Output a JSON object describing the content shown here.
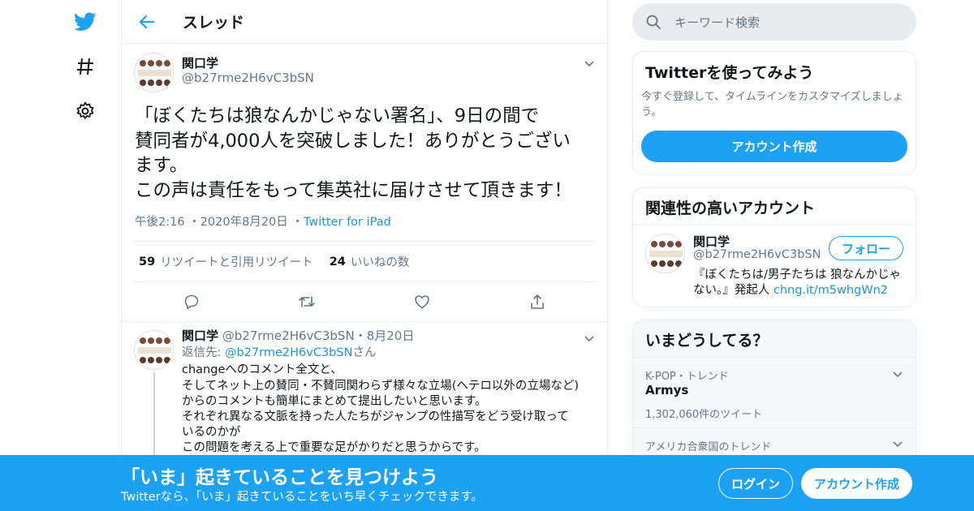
{
  "nav": {
    "icons": [
      "twitter-bird-icon",
      "hashtag-icon",
      "gear-icon"
    ]
  },
  "header": {
    "title": "スレッド"
  },
  "tweet": {
    "name": "関口学",
    "handle": "@b27rme2H6vC3bSN",
    "lines": [
      "「ぼくたちは狼なんかじゃない署名」、9日の間で",
      "賛同者が4,000人を突破しました！ありがとうござい",
      "ます。",
      "この声は責任をもって集英社に届けさせて頂きます！"
    ],
    "time": "午後2:16",
    "date": "2020年8月20日",
    "source": "Twitter for iPad",
    "retweets": "59",
    "retweets_label": "リツイートと引用リツイート",
    "likes": "24",
    "likes_label": "いいねの数"
  },
  "reply": {
    "name": "関口学",
    "handle": "@b27rme2H6vC3bSN",
    "date": "8月20日",
    "reply_to_prefix": "返信先: ",
    "reply_to_handle": "@b27rme2H6vC3bSN",
    "reply_to_suffix": "さん",
    "lines": [
      "changeへのコメント全文と、",
      "そしてネット上の賛同・不賛同関わらず様々な立場(ヘテロ以外の立場など)",
      "からのコメントも簡単にまとめて提出したいと思います。",
      "それぞれ異なる文脈を持った人たちがジャンプの性描写をどう受け取って",
      "いるのかが",
      "この問題を考える上で重要な足がかりだと思うからです。"
    ]
  },
  "search": {
    "placeholder": "キーワード検索"
  },
  "signup_card": {
    "title": "Twitterを使ってみよう",
    "subtitle": "今すぐ登録して、タイムラインをカスタマイズしましょう。",
    "button": "アカウント作成"
  },
  "related_card": {
    "title": "関連性の高いアカウント",
    "name": "関口学",
    "handle": "@b27rme2H6vC3bSN",
    "follow": "フォロー",
    "bio": "『ぼくたちは/男子たちは 狼なんかじゃない。』発起人 ",
    "bio_link": "chng.it/m5whgWn2"
  },
  "trends_card": {
    "title": "いまどうしてる？",
    "items": [
      {
        "context": "K-POP・トレンド",
        "name": "Armys",
        "count": "1,302,060件のツイート"
      },
      {
        "context": "アメリカ合衆国のトレンド",
        "name": "",
        "count": ""
      }
    ]
  },
  "bottom_bar": {
    "title": "「いま」起きていることを見つけよう",
    "subtitle": "Twitterなら、「いま」起きていることをいち早くチェックできます。",
    "login": "ログイン",
    "signup": "アカウント作成"
  },
  "colors": {
    "accent": "#1da1f2",
    "link": "#1b95e0",
    "muted": "#657786"
  }
}
